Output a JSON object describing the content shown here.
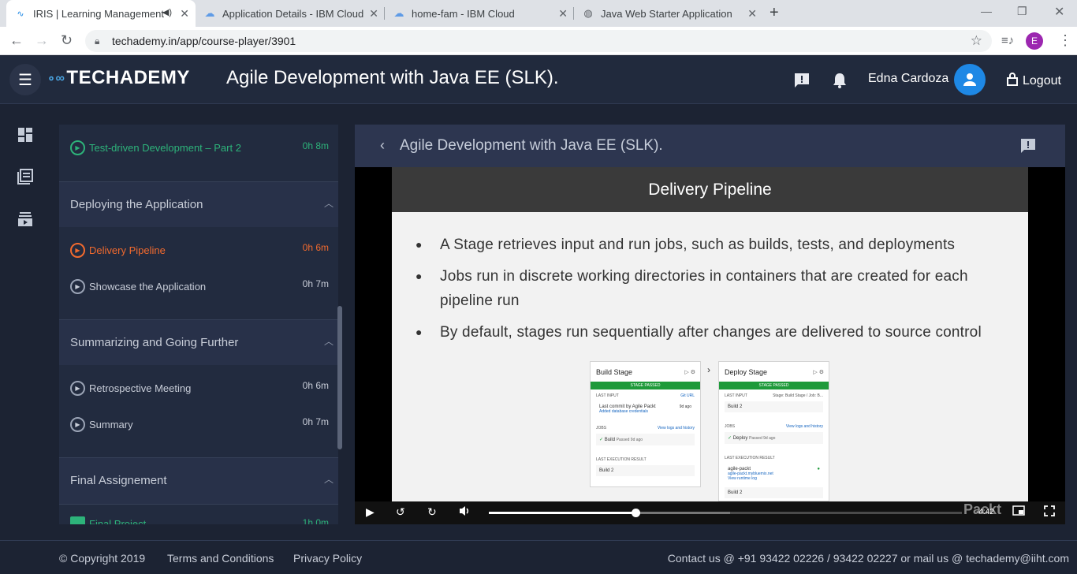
{
  "browser": {
    "tabs": [
      {
        "title": "IRIS | Learning Management",
        "active": true
      },
      {
        "title": "Application Details - IBM Cloud",
        "active": false
      },
      {
        "title": "home-fam - IBM Cloud",
        "active": false
      },
      {
        "title": "Java Web Starter Application",
        "active": false
      }
    ],
    "url": "techademy.in/app/course-player/3901",
    "profile_initial": "E"
  },
  "header": {
    "brand": "TECHADEMY",
    "course_title": "Agile Development with Java EE (SLK).",
    "user_name": "Edna Cardoza",
    "logout_label": "Logout"
  },
  "sidebar": {
    "lessons_top": [
      {
        "title": "Test-driven Development – Part 2",
        "duration": "0h 8m",
        "state": "done"
      }
    ],
    "sections": [
      {
        "title": "Deploying the Application",
        "lessons": [
          {
            "title": "Delivery Pipeline",
            "duration": "0h 6m",
            "state": "active"
          },
          {
            "title": "Showcase the Application",
            "duration": "0h 7m",
            "state": "idle"
          }
        ]
      },
      {
        "title": "Summarizing and Going Further",
        "lessons": [
          {
            "title": "Retrospective Meeting",
            "duration": "0h 6m",
            "state": "idle"
          },
          {
            "title": "Summary",
            "duration": "0h 7m",
            "state": "idle"
          }
        ]
      },
      {
        "title": "Final Assignement",
        "lessons": [
          {
            "title": "Final Project",
            "duration": "1h 0m",
            "state": "done"
          }
        ]
      }
    ]
  },
  "player": {
    "title": "Agile Development with Java EE (SLK).",
    "slide": {
      "heading": "Delivery Pipeline",
      "bullets": [
        "A Stage retrieves input and run jobs, such as builds, tests, and deployments",
        "Jobs run in discrete working directories in containers that are created for each pipeline run",
        "By default, stages run sequentially after changes are delivered to source control"
      ],
      "build_card": {
        "title": "Build Stage",
        "status": "STAGE PASSED",
        "last_input": "LAST INPUT",
        "git_url": "Git URL",
        "commit": "Last commit by Agile Packt",
        "commit_link": "Added database credentials",
        "ago": "9d ago",
        "jobs": "JOBS",
        "view_logs": "View logs and history",
        "job": "Build",
        "job_status": "Passed 9d ago",
        "last_exec": "LAST EXECUTION RESULT",
        "result": "Build 2"
      },
      "deploy_card": {
        "title": "Deploy Stage",
        "status": "STAGE PASSED",
        "last_input": "LAST INPUT",
        "input_src": "Stage: Build Stage / Job: B...",
        "input_row": "Build 2",
        "jobs": "JOBS",
        "view_logs": "View logs and history",
        "job": "Deploy",
        "job_status": "Passed 9d ago",
        "last_exec": "LAST EXECUTION RESULT",
        "app_name": "agile-packt",
        "app_url": "agile-packt.mybluemix.net",
        "runtime_link": "View runtime log",
        "result": "Build 2"
      },
      "watermark": "Packt"
    },
    "progress_fraction": 0.31,
    "buffered_fraction": 0.51,
    "time_left": "-4:42"
  },
  "footer": {
    "copyright": "© Copyright 2019",
    "terms": "Terms and Conditions",
    "privacy": "Privacy Policy",
    "contact": "Contact us @ +91 93422 02226 / 93422 02227 or mail us @ techademy@iiht.com"
  }
}
